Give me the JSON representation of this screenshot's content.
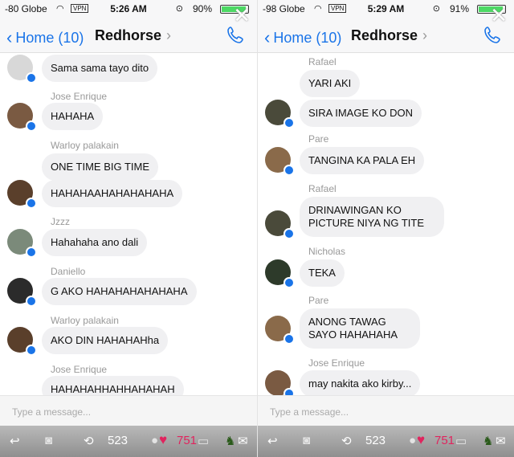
{
  "left": {
    "status": {
      "carrier": "-80 Globe",
      "vpn": "VPN",
      "time": "5:26 AM",
      "battery": "90%"
    },
    "nav": {
      "back": "Home",
      "back_count": "(10)",
      "title": "Redhorse"
    },
    "messages": [
      {
        "sender": "",
        "text": "Sama sama tayo dito",
        "avatar": true,
        "avatar_color": "#d8d8d8"
      },
      {
        "sender": "Jose Enrique",
        "text": "HAHAHA",
        "avatar": true,
        "avatar_color": "#7a5a42"
      },
      {
        "sender": "Warloy palakain",
        "text": "ONE TIME BIG TIME",
        "avatar": false
      },
      {
        "sender": "",
        "text": "HAHAHAAHAHAHAHAHA",
        "avatar": true,
        "avatar_color": "#5a3f2b"
      },
      {
        "sender": "Jzzz",
        "text": "Hahahaha ano dali",
        "avatar": true,
        "avatar_color": "#7b8a7a"
      },
      {
        "sender": "Daniello",
        "text": "G AKO HAHAHAHAHAHAHA",
        "avatar": true,
        "avatar_color": "#2b2b2b"
      },
      {
        "sender": "Warloy palakain",
        "text": "AKO DIN HAHAHAHha",
        "avatar": true,
        "avatar_color": "#5a3f2b"
      },
      {
        "sender": "Jose Enrique",
        "text": "HAHAHAHHAHHAHAHAH",
        "avatar": false
      }
    ]
  },
  "right": {
    "status": {
      "carrier": "-98 Globe",
      "vpn": "VPN",
      "time": "5:29 AM",
      "battery": "91%"
    },
    "nav": {
      "back": "Home",
      "back_count": "(10)",
      "title": "Redhorse"
    },
    "messages": [
      {
        "sender": "Rafael",
        "text": "YARI AKI",
        "avatar": false
      },
      {
        "sender": "",
        "text": "SIRA IMAGE KO DON",
        "avatar": true,
        "avatar_color": "#4a4a3a"
      },
      {
        "sender": "Pare",
        "text": "TANGINA KA PALA EH",
        "avatar": true,
        "avatar_color": "#8a6a4a"
      },
      {
        "sender": "Rafael",
        "text": "DRINAWINGAN KO PICTURE NIYA NG TITE",
        "avatar": true,
        "avatar_color": "#4a4a3a"
      },
      {
        "sender": "Nicholas",
        "text": "TEKA",
        "avatar": true,
        "avatar_color": "#2d3a2a"
      },
      {
        "sender": "Pare",
        "text": "ANONG TAWAG SAYO HAHAHAHA",
        "avatar": true,
        "avatar_color": "#8a6a4a"
      },
      {
        "sender": "Jose Enrique",
        "text": "may nakita ako kirby...",
        "avatar": true,
        "avatar_color": "#7a5a42"
      }
    ]
  },
  "composer": {
    "placeholder": "Type a message..."
  },
  "twitter_bar": {
    "retweets": "523",
    "likes": "751"
  },
  "colors": {
    "accent": "#1a74e8",
    "bubble": "#f0f0f2",
    "like": "#e0245e"
  },
  "icons": [
    "chevron-left-icon",
    "chevron-right-icon",
    "phone-icon",
    "close-icon",
    "messenger-badge-icon",
    "reply-icon",
    "camera-icon",
    "retweet-icon",
    "heart-icon",
    "mail-icon"
  ]
}
